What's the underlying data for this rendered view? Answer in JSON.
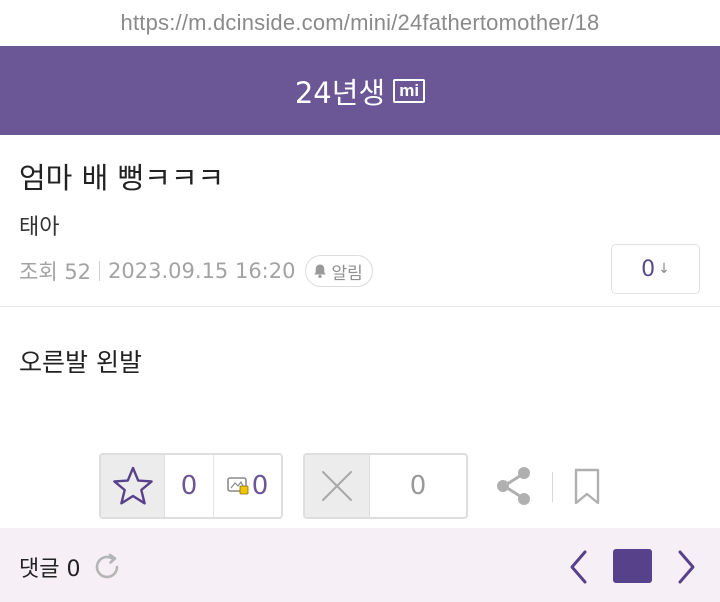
{
  "browser": {
    "url": "https://m.dcinside.com/mini/24fathertomother/18"
  },
  "header": {
    "gallery_name": "24년생",
    "badge": "mi"
  },
  "post": {
    "title": "엄마 배 뻥ㅋㅋㅋ",
    "author": "태아",
    "views_label": "조회 52",
    "datetime": "2023.09.15 16:20",
    "alarm_label": "알림",
    "sort_count": "0",
    "sort_arrow": "↓",
    "body": "오른발 왼발"
  },
  "reactions": {
    "recommend_count": "0",
    "fixed_recommend_count": "0",
    "not_recommend_count": "0"
  },
  "footer": {
    "comments_label": "댓글 0"
  },
  "colors": {
    "brand": "#6b5796",
    "brand_dark": "#56418a",
    "footer_bg": "#f6eff6"
  }
}
